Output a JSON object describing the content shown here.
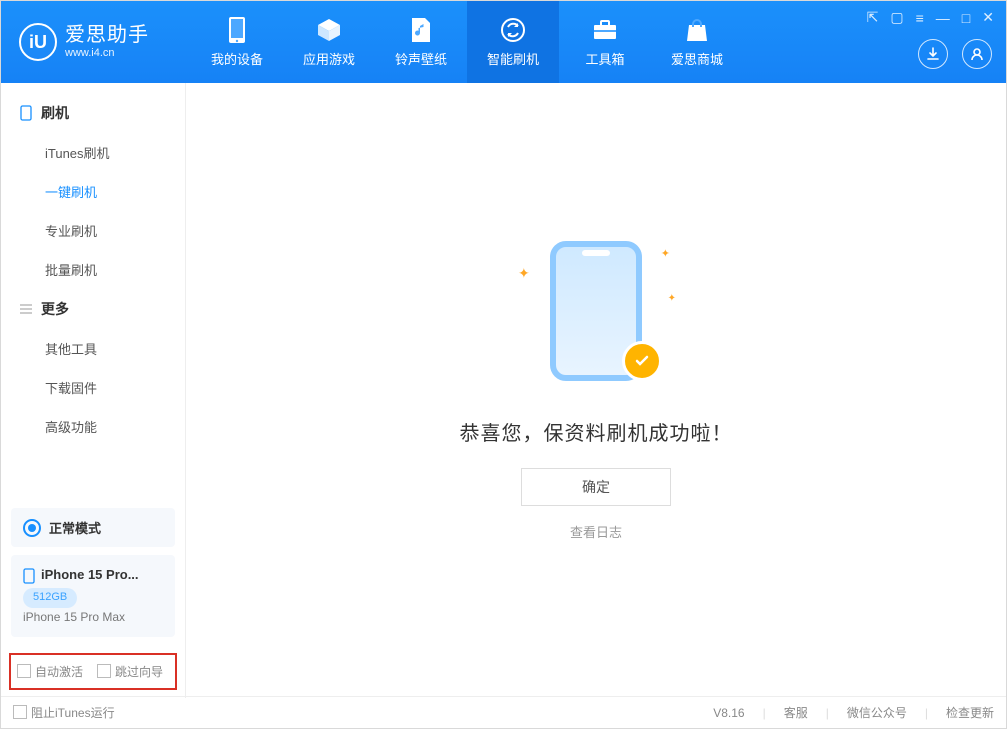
{
  "brand": {
    "cn": "爱思助手",
    "en": "www.i4.cn"
  },
  "nav": {
    "device": "我的设备",
    "apps": "应用游戏",
    "ringtones": "铃声壁纸",
    "flash": "智能刷机",
    "toolbox": "工具箱",
    "store": "爱思商城"
  },
  "sidebar": {
    "group_flash": "刷机",
    "items_flash": {
      "itunes": "iTunes刷机",
      "onekey": "一键刷机",
      "pro": "专业刷机",
      "batch": "批量刷机"
    },
    "group_more": "更多",
    "items_more": {
      "other": "其他工具",
      "firmware": "下载固件",
      "advanced": "高级功能"
    }
  },
  "device_panel": {
    "mode": "正常模式",
    "name": "iPhone 15 Pro...",
    "capacity": "512GB",
    "model": "iPhone 15 Pro Max"
  },
  "options": {
    "auto_activate": "自动激活",
    "skip_wizard": "跳过向导"
  },
  "main": {
    "success": "恭喜您，保资料刷机成功啦！",
    "ok": "确定",
    "view_log": "查看日志"
  },
  "footer": {
    "block_itunes": "阻止iTunes运行",
    "version": "V8.16",
    "support": "客服",
    "wechat": "微信公众号",
    "check_update": "检查更新"
  }
}
